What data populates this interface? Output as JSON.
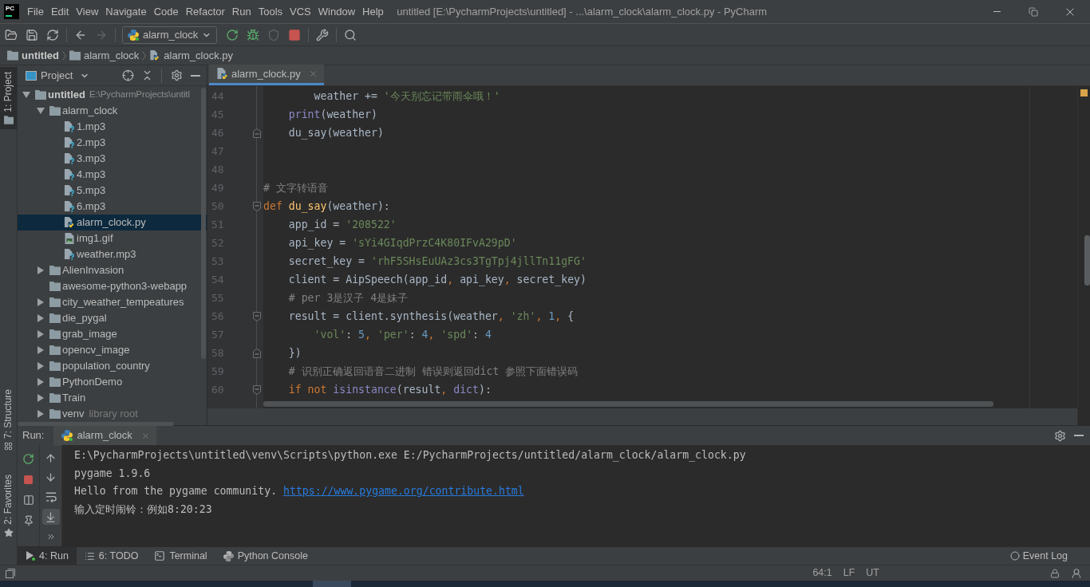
{
  "title_bar": {
    "logo": "PC",
    "menu": [
      "File",
      "Edit",
      "View",
      "Navigate",
      "Code",
      "Refactor",
      "Run",
      "Tools",
      "VCS",
      "Window",
      "Help"
    ],
    "title": "untitled [E:\\PycharmProjects\\untitled] - ...\\alarm_clock\\alarm_clock.py - PyCharm"
  },
  "toolbar": {
    "nav_buttons": [
      {
        "kind": "open",
        "disabled": false
      },
      {
        "kind": "save",
        "disabled": false
      },
      {
        "kind": "sync",
        "disabled": false
      },
      {
        "kind": "back",
        "disabled": false
      },
      {
        "kind": "forward",
        "disabled": true
      }
    ],
    "run_config": "alarm_clock",
    "run_buttons": [
      {
        "kind": "rerun",
        "disabled": false
      },
      {
        "kind": "debug",
        "disabled": false
      },
      {
        "kind": "coverage",
        "disabled": true
      },
      {
        "kind": "stop",
        "disabled": false
      },
      {
        "kind": "settings",
        "disabled": false
      },
      {
        "kind": "search",
        "disabled": false
      }
    ]
  },
  "breadcrumb": [
    {
      "label": "untitled",
      "kind": "root"
    },
    {
      "label": "alarm_clock",
      "kind": "folder"
    },
    {
      "label": "alarm_clock.py",
      "kind": "python"
    }
  ],
  "left_stripe": {
    "top": [
      {
        "label": "1: Project",
        "kind": "project",
        "selected": true
      }
    ],
    "bottom": [
      {
        "label": "7: Structure",
        "kind": "structure",
        "selected": false
      },
      {
        "label": "2: Favorites",
        "kind": "favorites",
        "selected": false
      }
    ]
  },
  "project_panel": {
    "title": "Project",
    "tree": [
      {
        "name": "untitled",
        "path": "E:\\PycharmProjects\\untitl",
        "kind": "root",
        "expanded": true,
        "selected": false,
        "children": [
          {
            "name": "alarm_clock",
            "kind": "folder",
            "expanded": true,
            "selected": false,
            "children": [
              {
                "name": "1.mp3",
                "kind": "unknown",
                "selected": false
              },
              {
                "name": "2.mp3",
                "kind": "unknown",
                "selected": false
              },
              {
                "name": "3.mp3",
                "kind": "unknown",
                "selected": false
              },
              {
                "name": "4.mp3",
                "kind": "unknown",
                "selected": false
              },
              {
                "name": "5.mp3",
                "kind": "unknown",
                "selected": false
              },
              {
                "name": "6.mp3",
                "kind": "unknown",
                "selected": false
              },
              {
                "name": "alarm_clock.py",
                "kind": "python",
                "selected": true
              },
              {
                "name": "img1.gif",
                "kind": "image",
                "selected": false
              },
              {
                "name": "weather.mp3",
                "kind": "unknown",
                "selected": false
              }
            ]
          },
          {
            "name": "AlienInvasion",
            "kind": "folder",
            "expanded": false,
            "selected": false
          },
          {
            "name": "awesome-python3-webapp",
            "kind": "leaf_folder",
            "selected": false
          },
          {
            "name": "city_weather_tempeatures",
            "kind": "folder",
            "expanded": false,
            "selected": false
          },
          {
            "name": "die_pygal",
            "kind": "folder",
            "expanded": false,
            "selected": false
          },
          {
            "name": "grab_image",
            "kind": "folder",
            "expanded": false,
            "selected": false
          },
          {
            "name": "opencv_image",
            "kind": "folder",
            "expanded": false,
            "selected": false
          },
          {
            "name": "population_country",
            "kind": "folder",
            "expanded": false,
            "selected": false
          },
          {
            "name": "PythonDemo",
            "kind": "folder",
            "expanded": false,
            "selected": false
          },
          {
            "name": "Train",
            "kind": "folder",
            "expanded": false,
            "selected": false
          },
          {
            "name": "venv",
            "note": "library root",
            "kind": "folder",
            "expanded": false,
            "selected": false
          }
        ]
      }
    ]
  },
  "editor": {
    "tab": {
      "label": "alarm_clock.py",
      "selected": true
    },
    "lines": [
      {
        "number": "44",
        "fold_start": false,
        "fold_end": false,
        "tokens": [
          {
            "text": "        weather += ",
            "kind": "plain"
          },
          {
            "text": "'今天别忘记带雨伞哦！'",
            "kind": "string"
          }
        ]
      },
      {
        "number": "45",
        "fold_start": false,
        "fold_end": false,
        "tokens": [
          {
            "text": "    print",
            "kind": "builtin"
          },
          {
            "text": "(weather)",
            "kind": "plain"
          }
        ]
      },
      {
        "number": "46",
        "fold_start": false,
        "fold_end": true,
        "tokens": [
          {
            "text": "    du_say(weather)",
            "kind": "plain"
          }
        ]
      },
      {
        "number": "47",
        "fold_start": false,
        "fold_end": false
      },
      {
        "number": "48",
        "fold_start": false,
        "fold_end": false
      },
      {
        "number": "49",
        "fold_start": false,
        "fold_end": false,
        "tokens": [
          {
            "text": "# 文字转语音",
            "kind": "comment"
          }
        ]
      },
      {
        "number": "50",
        "fold_start": true,
        "fold_end": false,
        "tokens": [
          {
            "text": "def ",
            "kind": "keyword"
          },
          {
            "text": "du_say",
            "kind": "funcdef"
          },
          {
            "text": "(weather):",
            "kind": "plain"
          }
        ]
      },
      {
        "number": "51",
        "fold_start": false,
        "fold_end": false,
        "tokens": [
          {
            "text": "    app_id = ",
            "kind": "plain"
          },
          {
            "text": "'208522'",
            "kind": "string"
          }
        ]
      },
      {
        "number": "52",
        "fold_start": false,
        "fold_end": false,
        "tokens": [
          {
            "text": "    api_key = ",
            "kind": "plain"
          },
          {
            "text": "'sYi4GIqdPrzC4K80IFvA29pD'",
            "kind": "string"
          }
        ]
      },
      {
        "number": "53",
        "fold_start": false,
        "fold_end": false,
        "tokens": [
          {
            "text": "    secret_key = ",
            "kind": "plain"
          },
          {
            "text": "'rhF5SHsEuUAz3cs3TgTpj4jllTn11gFG'",
            "kind": "string"
          }
        ]
      },
      {
        "number": "54",
        "fold_start": false,
        "fold_end": false,
        "tokens": [
          {
            "text": "    client = AipSpeech(app_id",
            "kind": "plain"
          },
          {
            "text": ", ",
            "kind": "keyword"
          },
          {
            "text": "api_key",
            "kind": "plain"
          },
          {
            "text": ", ",
            "kind": "keyword"
          },
          {
            "text": "secret_key)",
            "kind": "plain"
          }
        ]
      },
      {
        "number": "55",
        "fold_start": false,
        "fold_end": false,
        "tokens": [
          {
            "text": "    # per 3是汉子 4是妹子",
            "kind": "comment"
          }
        ]
      },
      {
        "number": "56",
        "fold_start": true,
        "fold_end": false,
        "tokens": [
          {
            "text": "    result = client.synthesis(weather",
            "kind": "plain"
          },
          {
            "text": ", ",
            "kind": "keyword"
          },
          {
            "text": "'zh'",
            "kind": "string"
          },
          {
            "text": ", ",
            "kind": "keyword"
          },
          {
            "text": "1",
            "kind": "number"
          },
          {
            "text": ", ",
            "kind": "keyword"
          },
          {
            "text": "{",
            "kind": "plain"
          }
        ]
      },
      {
        "number": "57",
        "fold_start": false,
        "fold_end": false,
        "tokens": [
          {
            "text": "        'vol'",
            "kind": "string"
          },
          {
            "text": ": ",
            "kind": "plain"
          },
          {
            "text": "5",
            "kind": "number"
          },
          {
            "text": ", ",
            "kind": "keyword"
          },
          {
            "text": "'per'",
            "kind": "string"
          },
          {
            "text": ": ",
            "kind": "plain"
          },
          {
            "text": "4",
            "kind": "number"
          },
          {
            "text": ", ",
            "kind": "keyword"
          },
          {
            "text": "'spd'",
            "kind": "string"
          },
          {
            "text": ": ",
            "kind": "plain"
          },
          {
            "text": "4",
            "kind": "number"
          }
        ]
      },
      {
        "number": "58",
        "fold_start": false,
        "fold_end": true,
        "tokens": [
          {
            "text": "    })",
            "kind": "plain"
          }
        ]
      },
      {
        "number": "59",
        "fold_start": false,
        "fold_end": false,
        "tokens": [
          {
            "text": "    # 识别正确返回语音二进制 错误则返回dict 参照下面错误码",
            "kind": "comment"
          }
        ]
      },
      {
        "number": "60",
        "fold_start": true,
        "fold_end": false,
        "tokens": [
          {
            "text": "    if not ",
            "kind": "keyword"
          },
          {
            "text": "isinstance",
            "kind": "builtin"
          },
          {
            "text": "(result",
            "kind": "plain"
          },
          {
            "text": ", ",
            "kind": "keyword"
          },
          {
            "text": "dict",
            "kind": "builtin"
          },
          {
            "text": "):",
            "kind": "plain"
          }
        ]
      }
    ]
  },
  "run_panel": {
    "label": "Run:",
    "tab": {
      "label": "alarm_clock",
      "selected": true
    },
    "tools_left": [
      {
        "kind": "rerun",
        "selected": false
      },
      {
        "kind": "stop",
        "selected": false
      },
      {
        "kind": "layout",
        "selected": false
      },
      {
        "kind": "pin",
        "selected": false
      }
    ],
    "tools_right": [
      {
        "kind": "up",
        "selected": false
      },
      {
        "kind": "down",
        "selected": false
      },
      {
        "kind": "wrap",
        "selected": false
      },
      {
        "kind": "scroll_end",
        "selected": true
      },
      {
        "kind": "more",
        "selected": false
      }
    ],
    "output": [
      {
        "segments": [
          {
            "text": "E:\\PycharmProjects\\untitled\\venv\\Scripts\\python.exe E:/PycharmProjects/untitled/alarm_clock/alarm_clock.py",
            "kind": "plain"
          }
        ]
      },
      {
        "segments": [
          {
            "text": "pygame 1.9.6",
            "kind": "plain"
          }
        ]
      },
      {
        "segments": [
          {
            "text": "Hello from the pygame community. ",
            "kind": "plain"
          },
          {
            "text": "https://www.pygame.org/contribute.html",
            "kind": "link"
          }
        ]
      },
      {
        "segments": [
          {
            "text": "输入定时闹铃：例如8:20:23",
            "kind": "plain"
          }
        ]
      }
    ]
  },
  "bottom_tabs": [
    {
      "label": "4: Run",
      "kind": "run",
      "selected": true
    },
    {
      "label": "6: TODO",
      "kind": "todo",
      "selected": false
    },
    {
      "label": "Terminal",
      "kind": "terminal",
      "selected": false
    },
    {
      "label": "Python Console",
      "kind": "console",
      "selected": false
    }
  ],
  "event_log": "Event Log",
  "status_bar": {
    "items": [
      "64:1",
      "LF",
      "UT"
    ]
  }
}
